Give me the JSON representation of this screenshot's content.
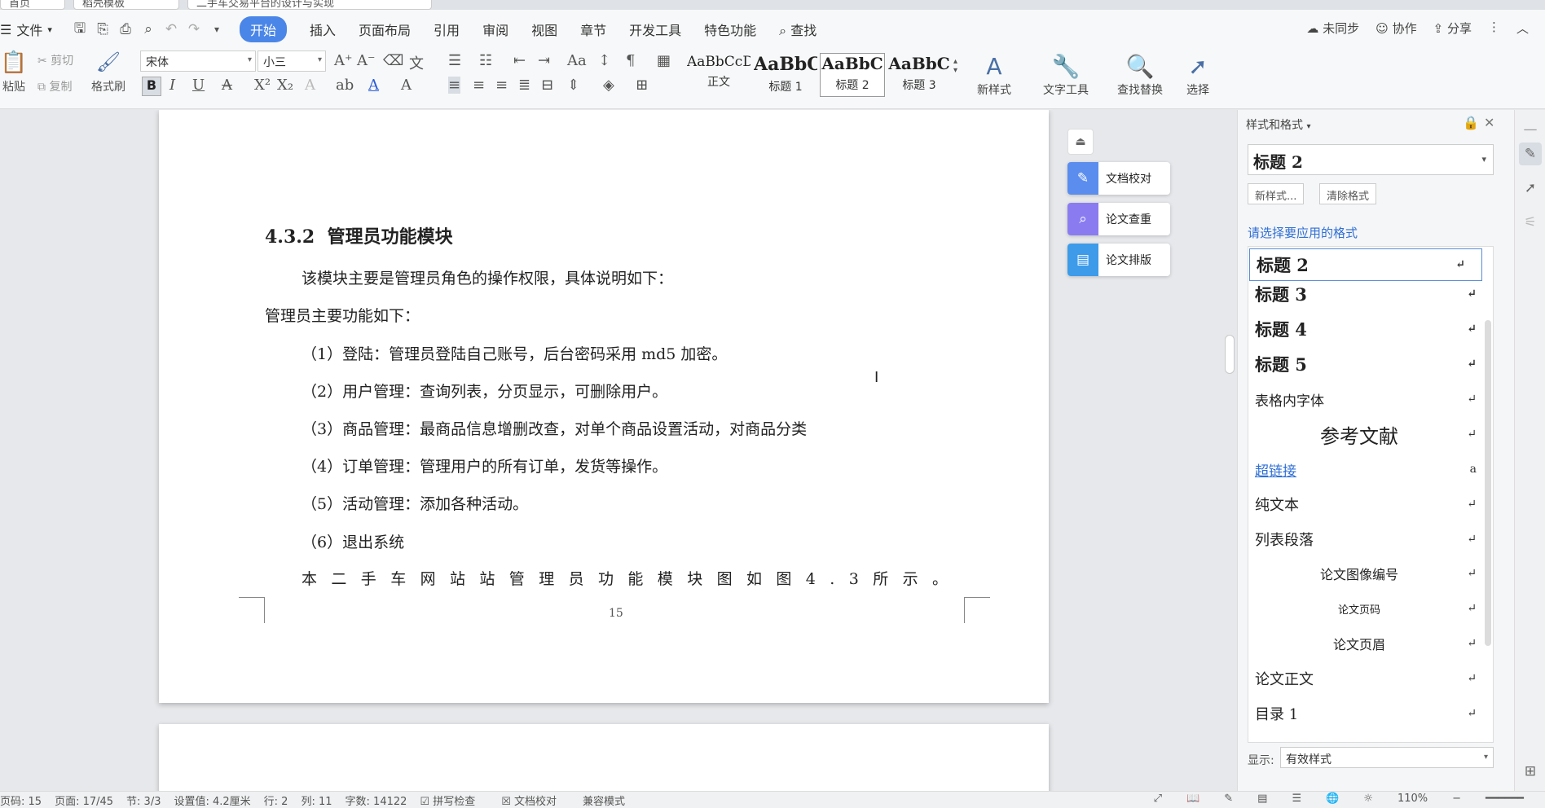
{
  "tabs": [
    {
      "label": "首页"
    },
    {
      "label": "稻壳模板"
    },
    {
      "label": "二手车交易平台的设计与实现"
    }
  ],
  "menubar": {
    "file_label": "文件",
    "items": [
      {
        "label": "开始",
        "active": true
      },
      {
        "label": "插入"
      },
      {
        "label": "页面布局"
      },
      {
        "label": "引用"
      },
      {
        "label": "审阅"
      },
      {
        "label": "视图"
      },
      {
        "label": "章节"
      },
      {
        "label": "开发工具"
      },
      {
        "label": "特色功能"
      },
      {
        "label": "查找"
      }
    ],
    "right": {
      "sync": "未同步",
      "collab": "协作",
      "share": "分享"
    }
  },
  "ribbon": {
    "cut": "剪切",
    "copy": "复制",
    "paste": "粘贴",
    "format_painter": "格式刷",
    "font_name": "宋体",
    "font_size": "小三",
    "styles": [
      {
        "preview": "AaBbCcD",
        "name": "正文"
      },
      {
        "preview": "AaBbC",
        "name": "标题 1"
      },
      {
        "preview": "AaBbC",
        "name": "标题 2"
      },
      {
        "preview": "AaBbC",
        "name": "标题 3"
      }
    ],
    "new_style": "新样式",
    "text_tools": "文字工具",
    "find_replace": "查找替换",
    "select": "选择"
  },
  "document": {
    "heading_num": "4.3.2",
    "heading_text": "管理员功能模块",
    "para1": "该模块主要是管理员角色的操作权限，具体说明如下：",
    "para2": "管理员主要功能如下：",
    "items": [
      "（1）登陆：管理员登陆自己账号，后台密码采用 md5 加密。",
      "（2）用户管理：查询列表，分页显示，可删除用户。",
      "（3）商品管理：最商品信息增删改查，对单个商品设置活动，对商品分类",
      "（4）订单管理：管理用户的所有订单，发货等操作。",
      "（5）活动管理：添加各种活动。",
      "（6）退出系统"
    ],
    "last_line": "本二手车网站站管理员功能模块图如图4.3所示。",
    "page_number": "15"
  },
  "float_buttons": [
    {
      "label": "文档校对"
    },
    {
      "label": "论文查重"
    },
    {
      "label": "论文排版"
    }
  ],
  "panel": {
    "title": "样式和格式",
    "current_style": "标题 2",
    "new_style_btn": "新样式...",
    "clear_btn": "清除格式",
    "pick_label": "请选择要应用的格式",
    "styles": [
      {
        "label": "标题 2"
      },
      {
        "label": "标题 3"
      },
      {
        "label": "标题 4"
      },
      {
        "label": "标题 5"
      },
      {
        "label": "表格内字体"
      },
      {
        "label": "参考文献"
      },
      {
        "label": "超链接"
      },
      {
        "label": "纯文本"
      },
      {
        "label": "列表段落"
      },
      {
        "label": "论文图像编号"
      },
      {
        "label": "论文页码"
      },
      {
        "label": "论文页眉"
      },
      {
        "label": "论文正文"
      },
      {
        "label": "目录 1"
      }
    ],
    "show_label": "显示:",
    "show_value": "有效样式"
  },
  "status": {
    "page_code": "页码: 15",
    "pages": "页面: 17/45",
    "section": "节: 3/3",
    "setting": "设置值: 4.2厘米",
    "row": "行: 2",
    "col": "列: 11",
    "word_count": "字数: 14122",
    "spell": "拼写检查",
    "proof": "文档校对",
    "compat": "兼容模式",
    "zoom": "110%"
  }
}
